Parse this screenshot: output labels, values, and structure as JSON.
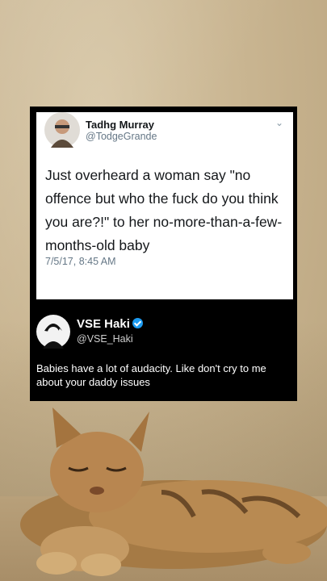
{
  "tweet": {
    "name": "Tadhg Murray",
    "handle": "@TodgeGrande",
    "text": "Just overheard a woman say \"no offence but who the fuck do you think you are?!\" to her no-more-than-a-few-months-old baby",
    "date": "7/5/17, 8:45 AM",
    "chevron_icon": "chevron-down-icon"
  },
  "reply": {
    "name": "VSE Haki",
    "handle": "@VSE_Haki",
    "text": "Babies have a lot of audacity. Like don't cry to me about your daddy issues",
    "verified_icon": "verified-badge-icon"
  },
  "colors": {
    "card_bg": "#000000",
    "tweet_bg": "#ffffff",
    "verified": "#1d9bf0",
    "wall": "#c9b591"
  }
}
